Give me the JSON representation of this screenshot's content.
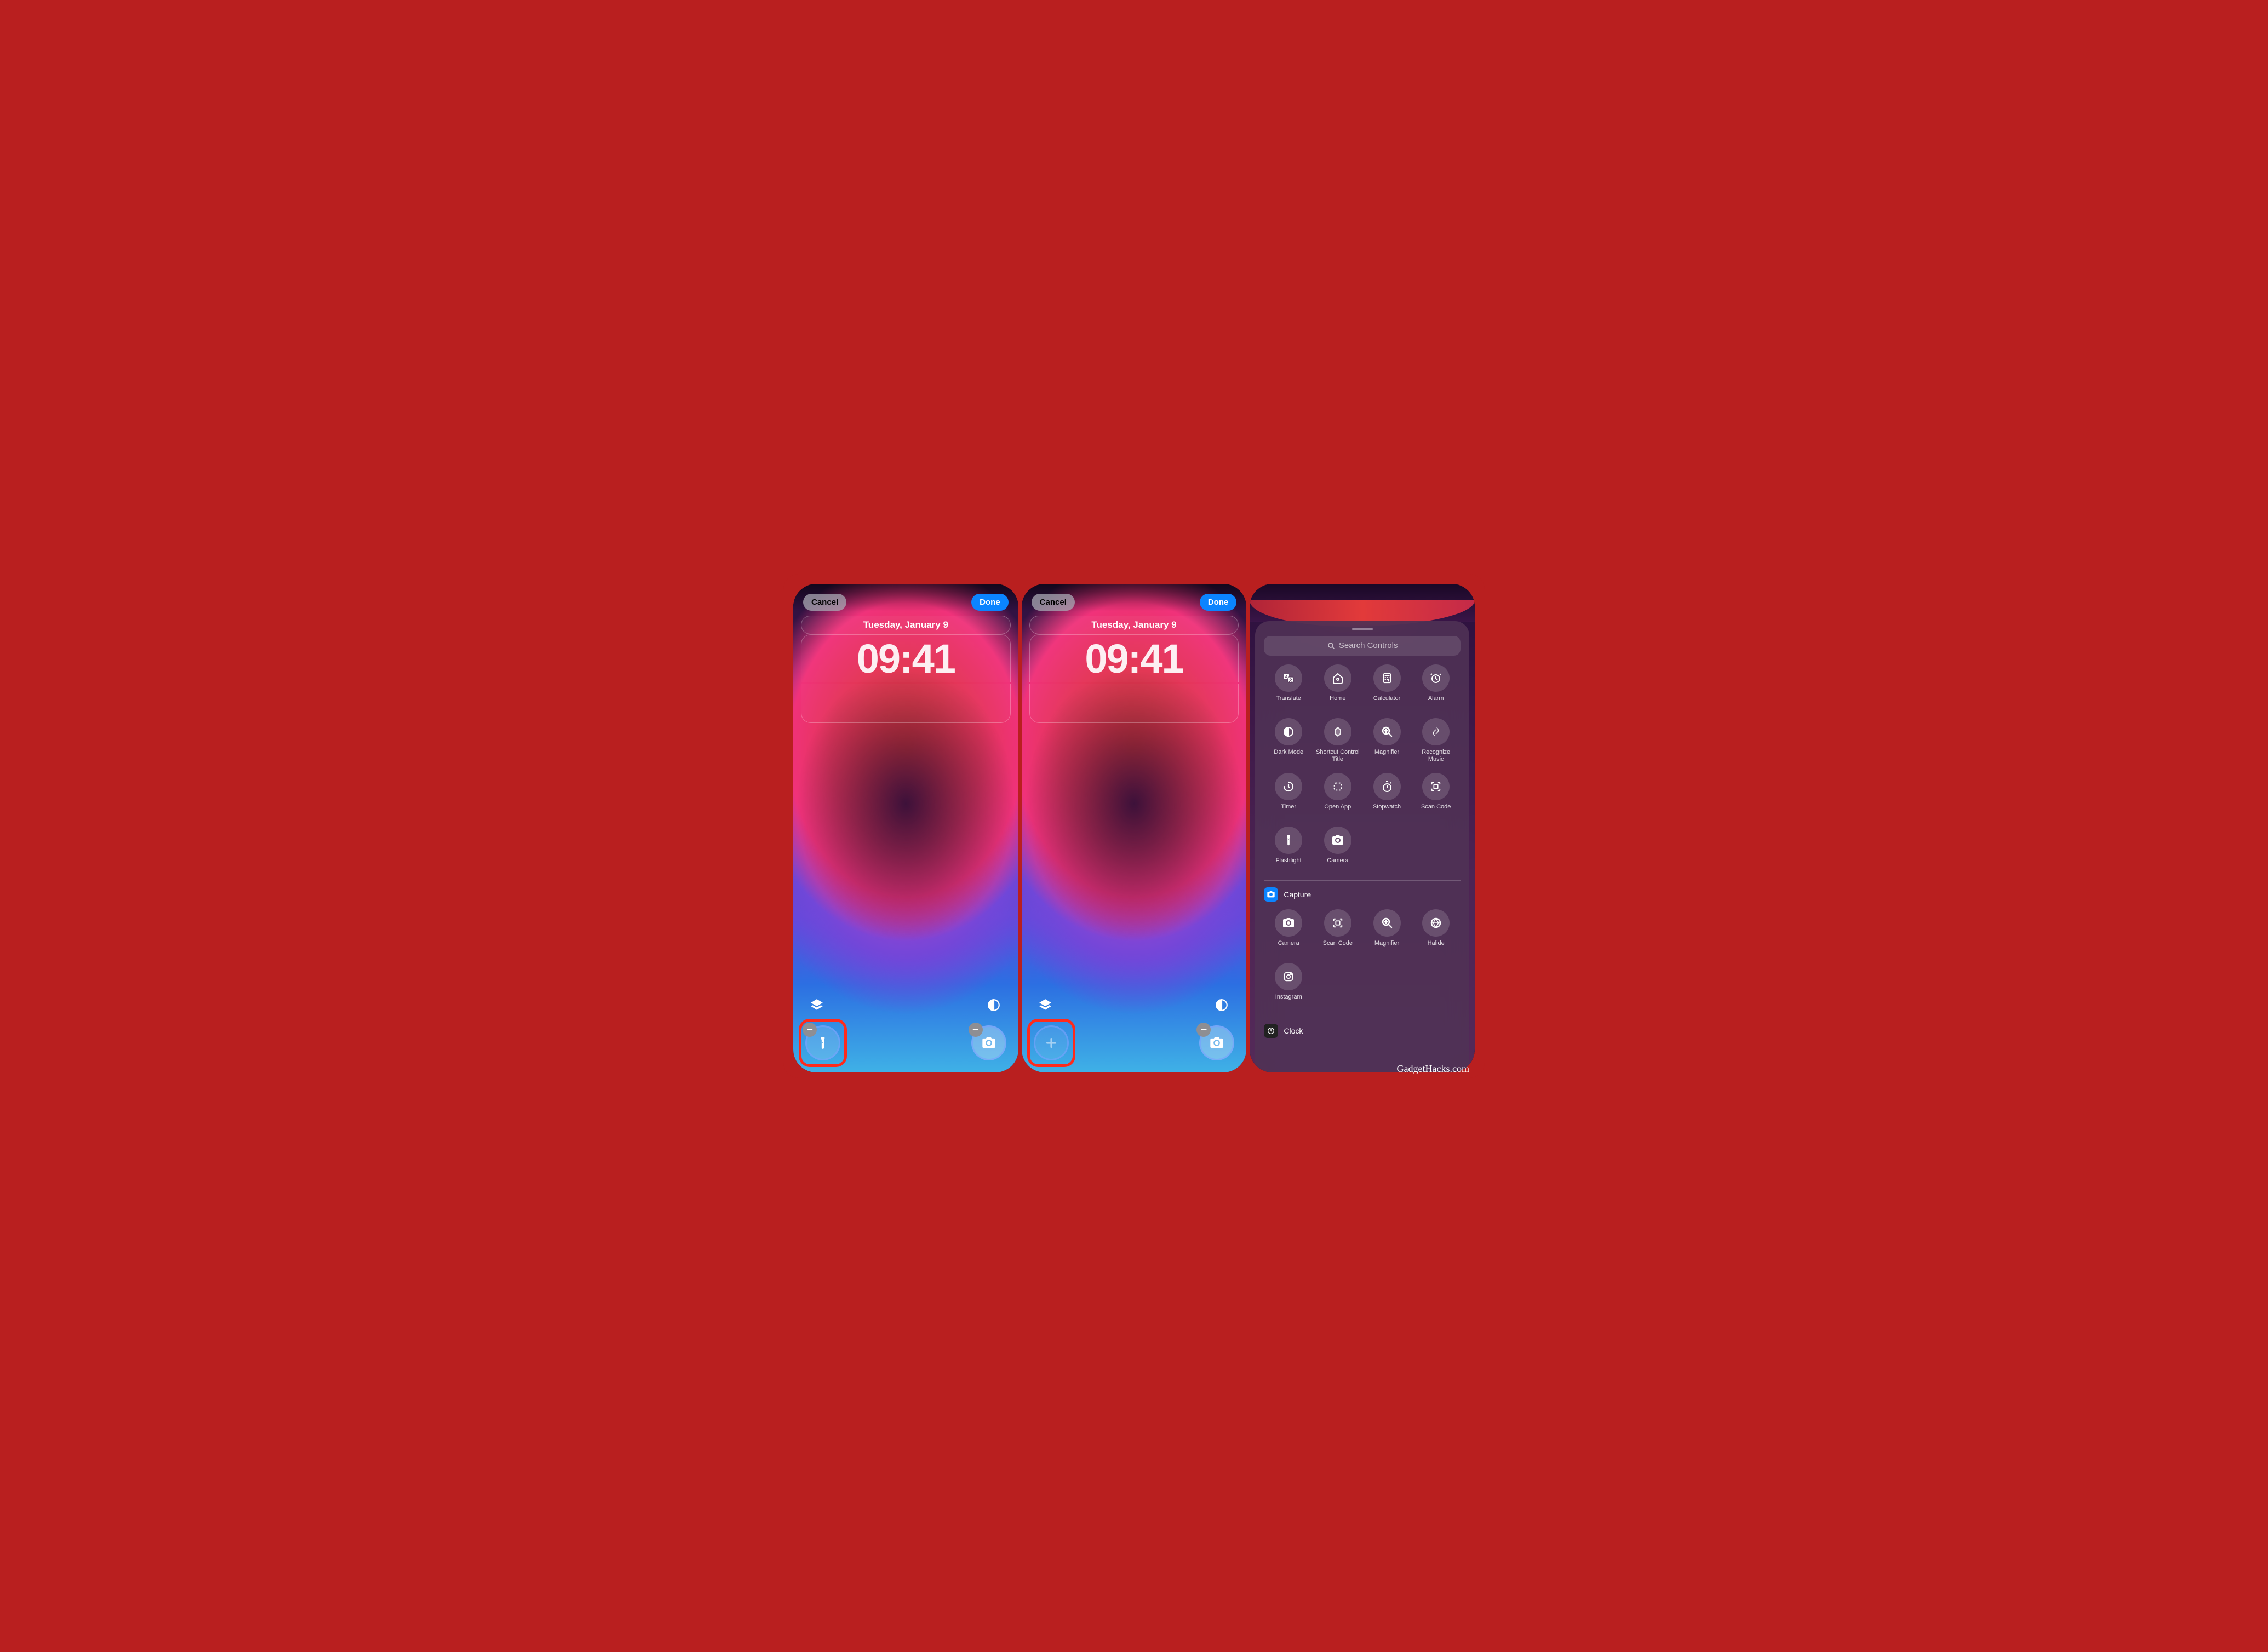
{
  "watermark": "GadgetHacks.com",
  "topbar": {
    "cancel": "Cancel",
    "done": "Done"
  },
  "lockscreen": {
    "date": "Tuesday, January 9",
    "time": "09:41"
  },
  "search": {
    "placeholder": "Search Controls"
  },
  "controls": [
    {
      "label": "Translate",
      "icon": "translate"
    },
    {
      "label": "Home",
      "icon": "home"
    },
    {
      "label": "Calculator",
      "icon": "calculator"
    },
    {
      "label": "Alarm",
      "icon": "alarm"
    },
    {
      "label": "Dark Mode",
      "icon": "darkmode"
    },
    {
      "label": "Shortcut Control Title",
      "icon": "shortcut"
    },
    {
      "label": "Magnifier",
      "icon": "magnifier"
    },
    {
      "label": "Recognize Music",
      "icon": "shazam"
    },
    {
      "label": "Timer",
      "icon": "timer"
    },
    {
      "label": "Open App",
      "icon": "openapp"
    },
    {
      "label": "Stopwatch",
      "icon": "stopwatch"
    },
    {
      "label": "Scan Code",
      "icon": "scancode"
    },
    {
      "label": "Flashlight",
      "icon": "flashlight"
    },
    {
      "label": "Camera",
      "icon": "camera"
    }
  ],
  "sections": [
    {
      "title": "Capture",
      "iconColor": "blue",
      "icon": "camera-fill",
      "items": [
        {
          "label": "Camera",
          "icon": "camera"
        },
        {
          "label": "Scan Code",
          "icon": "scancode"
        },
        {
          "label": "Magnifier",
          "icon": "magnifier"
        },
        {
          "label": "Halide",
          "icon": "halide"
        },
        {
          "label": "Instagram",
          "icon": "instagram"
        }
      ]
    },
    {
      "title": "Clock",
      "iconColor": "dark",
      "icon": "clock",
      "items": []
    }
  ]
}
